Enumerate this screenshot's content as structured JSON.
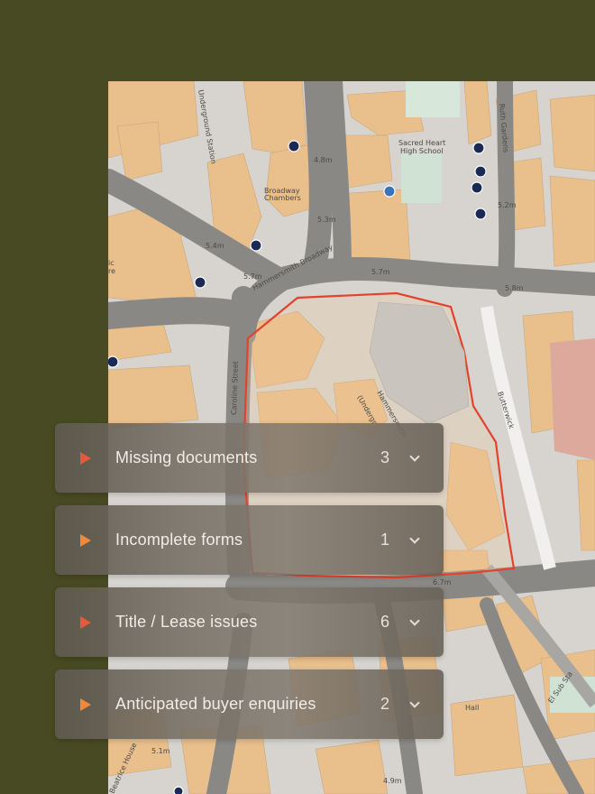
{
  "map": {
    "labels": {
      "underground_station": "Underground Station",
      "sacred_heart_1": "Sacred Heart",
      "sacred_heart_2": "High School",
      "broadway_1": "Broadway",
      "broadway_2": "Chambers",
      "hammersmith_broadway": "Hammersmith Broadway",
      "caroline_street": "Caroline Street",
      "butterwick": "Butterwick",
      "hammersmith": "Hammersmith",
      "underground": "(Undergr",
      "hall": "Hall",
      "el_sub_sta": "El Sub Sta",
      "beatrice_house": "Beatrice House",
      "ruth_gardens": "Ruth Gardens",
      "h_4_8": "4.8m",
      "h_5_3": "5.3m",
      "h_5_4": "5.4m",
      "h_5_7a": "5.7m",
      "h_5_7b": "5.7m",
      "h_5_8": "5.8m",
      "h_6_7": "6.7m",
      "h_5_2": "5.2m",
      "h_5_1": "5.1m",
      "h_4_9": "4.9m",
      "partial_re": "re",
      "partial_ic": "ic"
    },
    "colors": {
      "building": "#e9bf8c",
      "road": "#8a8885",
      "ground": "#d7d4d0",
      "boundary": "#e2432e",
      "marker": "#1a2a54",
      "marker_selected": "#3a74b8"
    }
  },
  "issues": [
    {
      "label": "Missing documents",
      "count": "3",
      "color": "#e65a3a"
    },
    {
      "label": "Incomplete forms",
      "count": "1",
      "color": "#f08a3a"
    },
    {
      "label": "Title / Lease issues",
      "count": "6",
      "color": "#e65a3a"
    },
    {
      "label": "Anticipated buyer enquiries",
      "count": "2",
      "color": "#f08a3a"
    }
  ]
}
